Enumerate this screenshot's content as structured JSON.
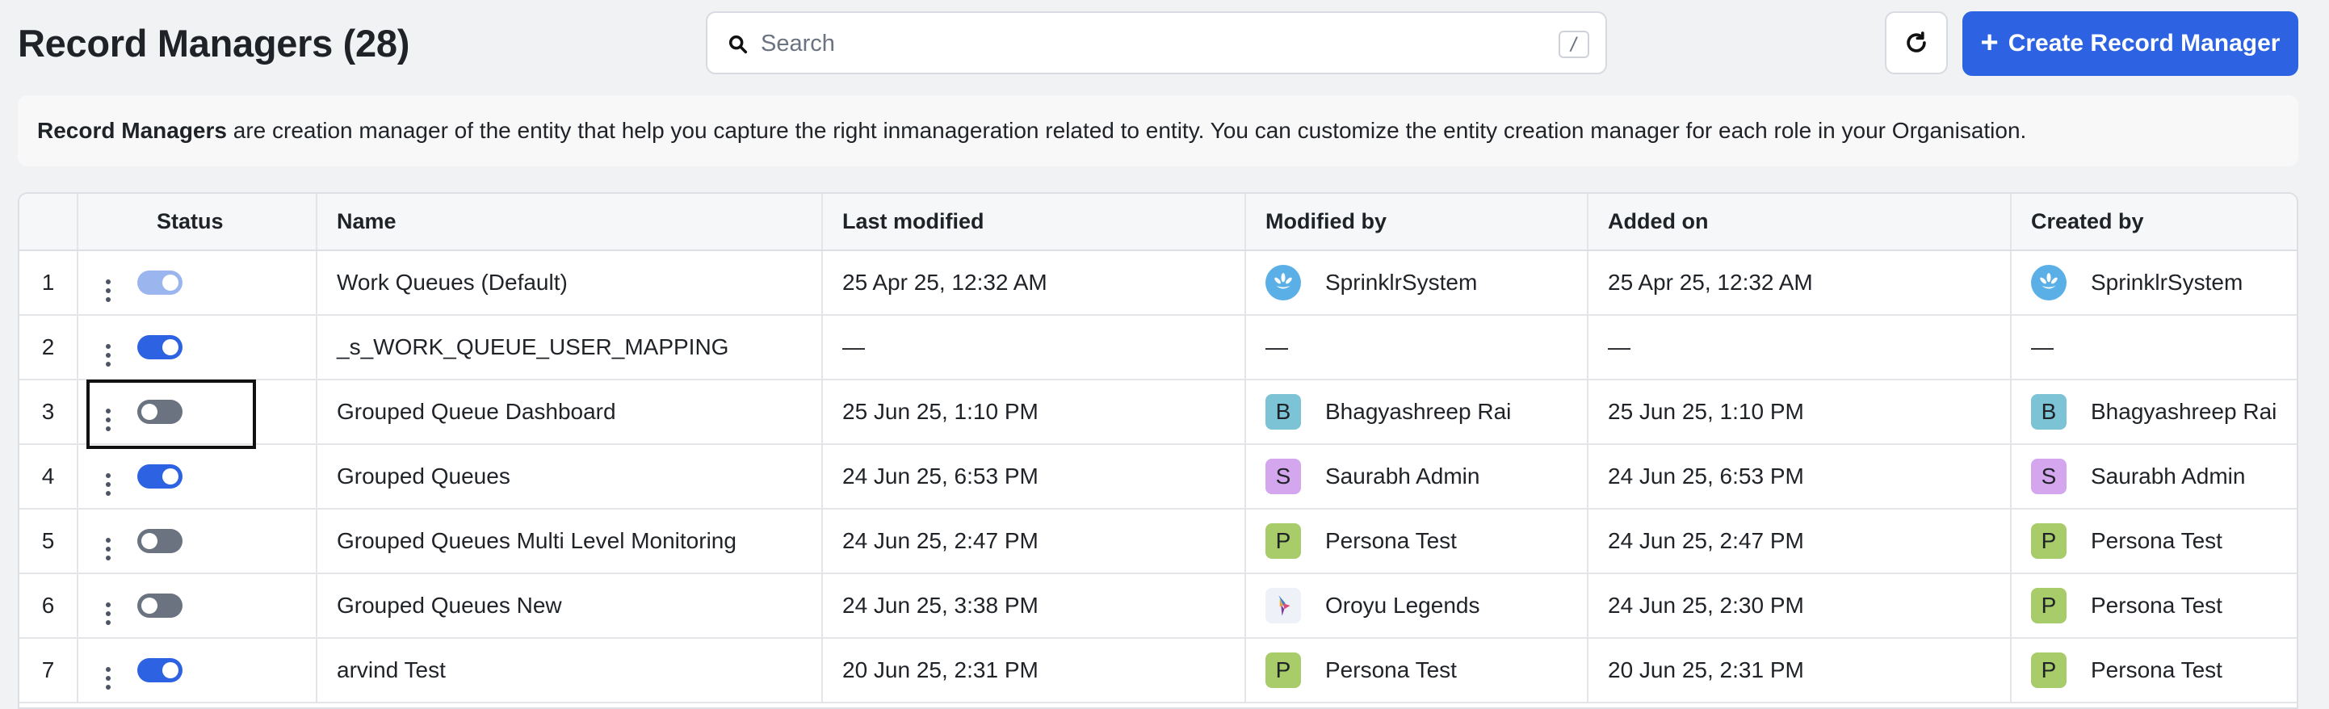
{
  "header": {
    "title": "Record Managers (28)",
    "search_placeholder": "Search",
    "search_shortcut": "/",
    "create_label": "Create Record Manager",
    "plus_glyph": "+"
  },
  "banner": {
    "bold": "Record Managers",
    "text": " are creation manager of the entity that help you capture the right inmanageration related to entity. You can customize the entity creation manager for each role in your Organisation."
  },
  "columns": [
    "Status",
    "Name",
    "Last modified",
    "Modified by",
    "Added on",
    "Created by"
  ],
  "rows": [
    {
      "index": "1",
      "status": "on-disabled",
      "name": "Work Queues (Default)",
      "last_modified": "25 Apr 25, 12:32 AM",
      "modified_by": {
        "name": "SprinklrSystem",
        "avatar": "sprinklr-logo-icon",
        "initial": "",
        "color": "#5ab0e6"
      },
      "added_on": "25 Apr 25, 12:32 AM",
      "created_by": {
        "name": "SprinklrSystem",
        "avatar": "sprinklr-logo-icon",
        "initial": "",
        "color": "#5ab0e6"
      }
    },
    {
      "index": "2",
      "status": "on",
      "name": "_s_WORK_QUEUE_USER_MAPPING",
      "last_modified": "—",
      "modified_by": {
        "name": "—",
        "avatar": "",
        "initial": "",
        "color": ""
      },
      "added_on": "—",
      "created_by": {
        "name": "—",
        "avatar": "",
        "initial": "",
        "color": ""
      }
    },
    {
      "index": "3",
      "status": "off",
      "name": "Grouped Queue Dashboard",
      "last_modified": "25 Jun 25, 1:10 PM",
      "modified_by": {
        "name": "Bhagyashreep Rai",
        "avatar": "initial",
        "initial": "B",
        "color": "#7cc3d6"
      },
      "added_on": "25 Jun 25, 1:10 PM",
      "created_by": {
        "name": "Bhagyashreep Rai",
        "avatar": "initial",
        "initial": "B",
        "color": "#7cc3d6"
      }
    },
    {
      "index": "4",
      "status": "on",
      "name": "Grouped Queues",
      "last_modified": "24 Jun 25, 6:53 PM",
      "modified_by": {
        "name": "Saurabh Admin",
        "avatar": "initial",
        "initial": "S",
        "color": "#d4a6ee"
      },
      "added_on": "24 Jun 25, 6:53 PM",
      "created_by": {
        "name": "Saurabh Admin",
        "avatar": "initial",
        "initial": "S",
        "color": "#d4a6ee"
      }
    },
    {
      "index": "5",
      "status": "off",
      "name": "Grouped Queues Multi Level Monitoring",
      "last_modified": "24 Jun 25, 2:47 PM",
      "modified_by": {
        "name": "Persona Test",
        "avatar": "initial",
        "initial": "P",
        "color": "#a8cc6a"
      },
      "added_on": "24 Jun 25, 2:47 PM",
      "created_by": {
        "name": "Persona Test",
        "avatar": "initial",
        "initial": "P",
        "color": "#a8cc6a"
      }
    },
    {
      "index": "6",
      "status": "off",
      "name": "Grouped Queues New",
      "last_modified": "24 Jun 25, 3:38 PM",
      "modified_by": {
        "name": "Oroyu Legends",
        "avatar": "bird-logo-icon",
        "initial": "",
        "color": "#eef2f8"
      },
      "added_on": "24 Jun 25, 2:30 PM",
      "created_by": {
        "name": "Persona Test",
        "avatar": "initial",
        "initial": "P",
        "color": "#a8cc6a"
      }
    },
    {
      "index": "7",
      "status": "on",
      "name": "arvind Test",
      "last_modified": "20 Jun 25, 2:31 PM",
      "modified_by": {
        "name": "Persona Test",
        "avatar": "initial",
        "initial": "P",
        "color": "#a8cc6a"
      },
      "added_on": "20 Jun 25, 2:31 PM",
      "created_by": {
        "name": "Persona Test",
        "avatar": "initial",
        "initial": "P",
        "color": "#a8cc6a"
      }
    }
  ],
  "colors": {
    "accent": "#2d63e2",
    "toggle_on": "#2d63e2",
    "toggle_on_disabled": "#9bb5ee",
    "toggle_off": "#6b7280"
  }
}
